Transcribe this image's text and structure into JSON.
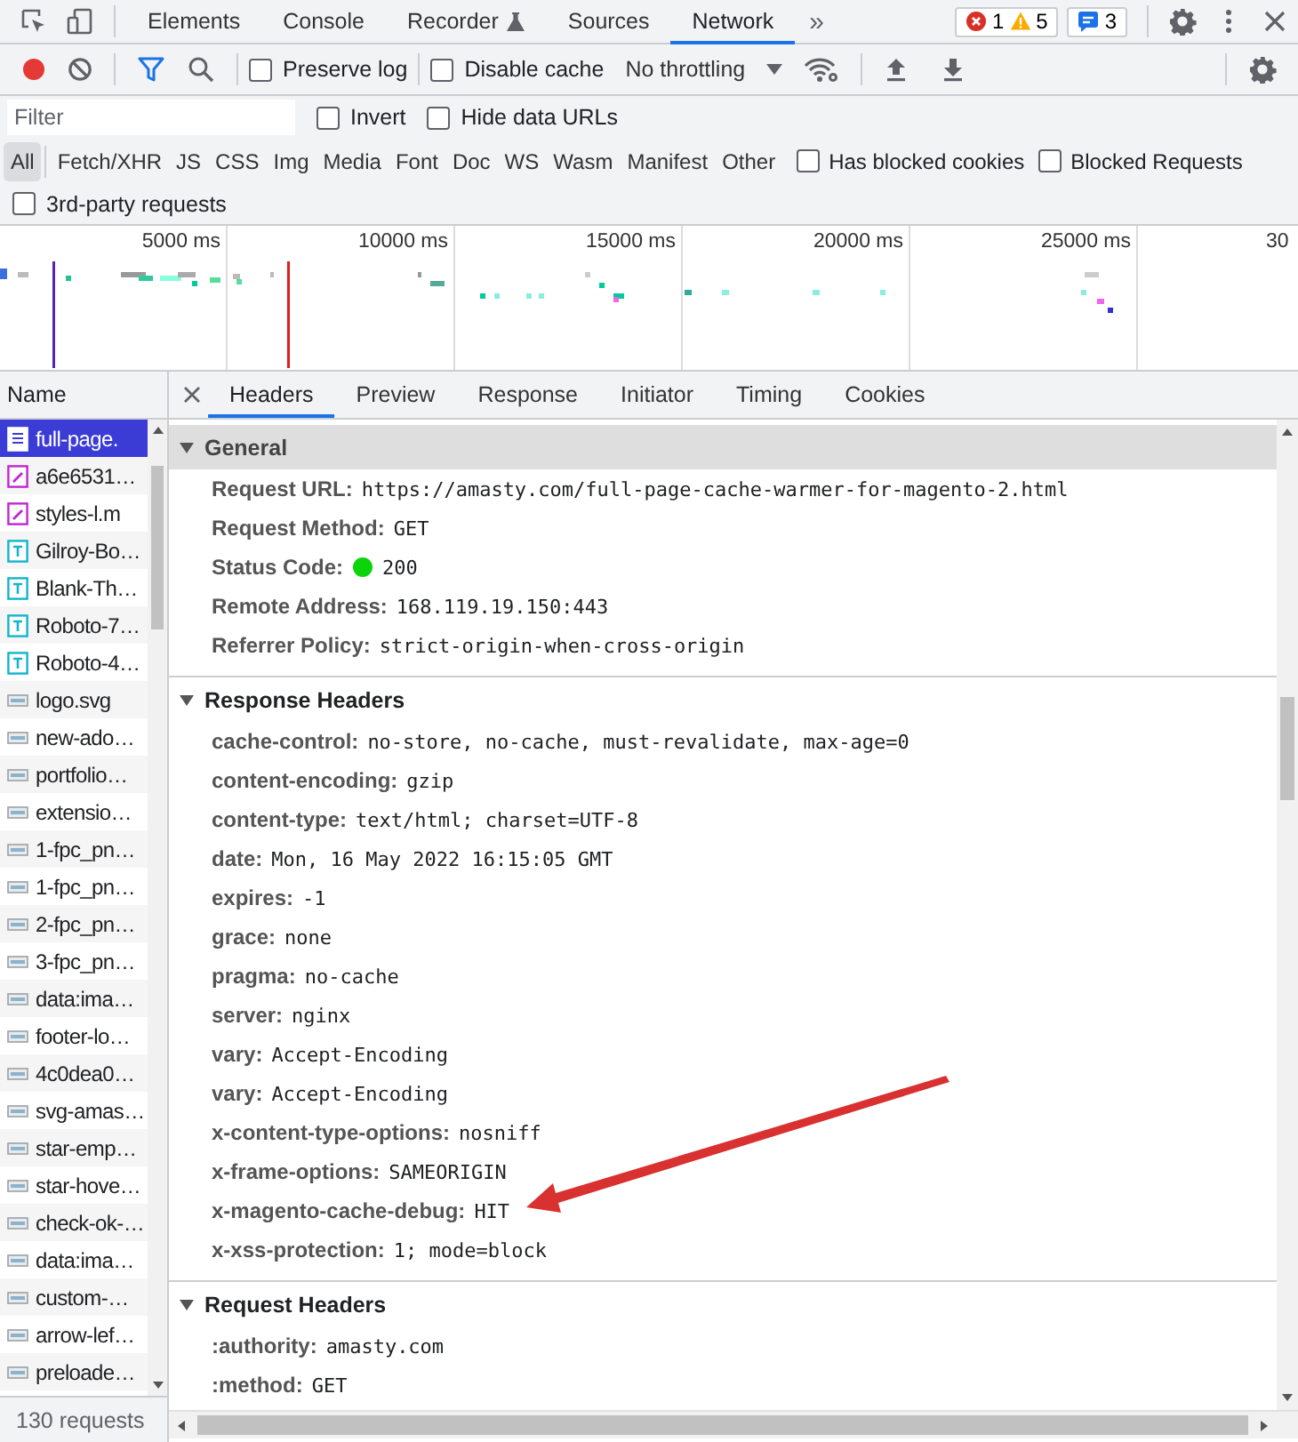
{
  "devtools_tabs": [
    {
      "label": "Elements",
      "selected": false,
      "experimental": false
    },
    {
      "label": "Console",
      "selected": false,
      "experimental": false
    },
    {
      "label": "Recorder",
      "selected": false,
      "experimental": true
    },
    {
      "label": "Sources",
      "selected": false,
      "experimental": false
    },
    {
      "label": "Network",
      "selected": true,
      "experimental": false
    }
  ],
  "more_tabs": "»",
  "counters": [
    {
      "kind": "error",
      "count": "1"
    },
    {
      "kind": "warning",
      "count": "5"
    },
    {
      "kind": "message",
      "count": "3"
    }
  ],
  "toolbar": {
    "recording": true,
    "options": [
      {
        "label": "Preserve log",
        "checked": false
      },
      {
        "label": "Disable cache",
        "checked": false
      }
    ],
    "throttling": "No throttling"
  },
  "filter": {
    "placeholder": "Filter",
    "options": [
      {
        "label": "Invert",
        "checked": false
      },
      {
        "label": "Hide data URLs",
        "checked": false
      }
    ]
  },
  "type_filters": [
    {
      "label": "All",
      "selected": true
    },
    {
      "label": "Fetch/XHR",
      "selected": false
    },
    {
      "label": "JS",
      "selected": false
    },
    {
      "label": "CSS",
      "selected": false
    },
    {
      "label": "Img",
      "selected": false
    },
    {
      "label": "Media",
      "selected": false
    },
    {
      "label": "Font",
      "selected": false
    },
    {
      "label": "Doc",
      "selected": false
    },
    {
      "label": "WS",
      "selected": false
    },
    {
      "label": "Wasm",
      "selected": false
    },
    {
      "label": "Manifest",
      "selected": false
    },
    {
      "label": "Other",
      "selected": false
    }
  ],
  "type_options": [
    {
      "label": "Has blocked cookies",
      "checked": false
    },
    {
      "label": "Blocked Requests",
      "checked": false
    }
  ],
  "third_party": {
    "label": "3rd-party requests",
    "checked": false
  },
  "timeline": {
    "ticks": [
      "5000 ms",
      "10000 ms",
      "15000 ms",
      "20000 ms",
      "25000 ms",
      "30"
    ]
  },
  "requests": {
    "column": "Name",
    "status": "130 requests",
    "rows": [
      {
        "name": "full-page.",
        "kind": "document",
        "selected": true
      },
      {
        "name": "a6e6531…",
        "kind": "script",
        "selected": false
      },
      {
        "name": "styles-l.m",
        "kind": "script",
        "selected": false
      },
      {
        "name": "Gilroy-Bo…",
        "kind": "font",
        "selected": false
      },
      {
        "name": "Blank-Th…",
        "kind": "font",
        "selected": false
      },
      {
        "name": "Roboto-7…",
        "kind": "font",
        "selected": false
      },
      {
        "name": "Roboto-4…",
        "kind": "font",
        "selected": false
      },
      {
        "name": "logo.svg",
        "kind": "image",
        "selected": false
      },
      {
        "name": "new-ado…",
        "kind": "image",
        "selected": false
      },
      {
        "name": "portfolio…",
        "kind": "image",
        "selected": false
      },
      {
        "name": "extensio…",
        "kind": "image",
        "selected": false
      },
      {
        "name": "1-fpc_pn…",
        "kind": "image",
        "selected": false
      },
      {
        "name": "1-fpc_pn…",
        "kind": "image",
        "selected": false
      },
      {
        "name": "2-fpc_pn…",
        "kind": "image",
        "selected": false
      },
      {
        "name": "3-fpc_pn…",
        "kind": "image",
        "selected": false
      },
      {
        "name": "data:ima…",
        "kind": "image",
        "selected": false
      },
      {
        "name": "footer-lo…",
        "kind": "image",
        "selected": false
      },
      {
        "name": "4c0dea0…",
        "kind": "image",
        "selected": false
      },
      {
        "name": "svg-amas…",
        "kind": "image",
        "selected": false
      },
      {
        "name": "star-emp…",
        "kind": "image",
        "selected": false
      },
      {
        "name": "star-hove…",
        "kind": "image",
        "selected": false
      },
      {
        "name": "check-ok-…",
        "kind": "image",
        "selected": false
      },
      {
        "name": "data:ima…",
        "kind": "image",
        "selected": false
      },
      {
        "name": "custom-…",
        "kind": "image",
        "selected": false
      },
      {
        "name": "arrow-lef…",
        "kind": "image",
        "selected": false
      },
      {
        "name": "preloade…",
        "kind": "image",
        "selected": false
      }
    ]
  },
  "details": {
    "tabs": [
      {
        "label": "Headers",
        "selected": true
      },
      {
        "label": "Preview",
        "selected": false
      },
      {
        "label": "Response",
        "selected": false
      },
      {
        "label": "Initiator",
        "selected": false
      },
      {
        "label": "Timing",
        "selected": false
      },
      {
        "label": "Cookies",
        "selected": false
      }
    ],
    "sections": [
      {
        "title": "General",
        "expanded": true,
        "highlighted": true,
        "rows": [
          {
            "key": "Request URL:",
            "value": "https://amasty.com/full-page-cache-warmer-for-magento-2.html",
            "kind": "plain"
          },
          {
            "key": "Request Method:",
            "value": "GET",
            "kind": "plain"
          },
          {
            "key": "Status Code:",
            "value": "200",
            "kind": "status"
          },
          {
            "key": "Remote Address:",
            "value": "168.119.19.150:443",
            "kind": "plain"
          },
          {
            "key": "Referrer Policy:",
            "value": "strict-origin-when-cross-origin",
            "kind": "plain"
          }
        ]
      },
      {
        "title": "Response Headers",
        "expanded": true,
        "highlighted": false,
        "rows": [
          {
            "key": "cache-control:",
            "value": "no-store, no-cache, must-revalidate, max-age=0",
            "kind": "plain"
          },
          {
            "key": "content-encoding:",
            "value": "gzip",
            "kind": "plain"
          },
          {
            "key": "content-type:",
            "value": "text/html; charset=UTF-8",
            "kind": "plain"
          },
          {
            "key": "date:",
            "value": "Mon, 16 May 2022 16:15:05 GMT",
            "kind": "plain"
          },
          {
            "key": "expires:",
            "value": "-1",
            "kind": "plain"
          },
          {
            "key": "grace:",
            "value": "none",
            "kind": "plain"
          },
          {
            "key": "pragma:",
            "value": "no-cache",
            "kind": "plain"
          },
          {
            "key": "server:",
            "value": "nginx",
            "kind": "plain"
          },
          {
            "key": "vary:",
            "value": "Accept-Encoding",
            "kind": "plain"
          },
          {
            "key": "vary:",
            "value": "Accept-Encoding",
            "kind": "plain"
          },
          {
            "key": "x-content-type-options:",
            "value": "nosniff",
            "kind": "plain"
          },
          {
            "key": "x-frame-options:",
            "value": "SAMEORIGIN",
            "kind": "plain"
          },
          {
            "key": "x-magento-cache-debug:",
            "value": "HIT",
            "kind": "plain"
          },
          {
            "key": "x-xss-protection:",
            "value": "1; mode=block",
            "kind": "plain"
          }
        ]
      },
      {
        "title": "Request Headers",
        "expanded": true,
        "highlighted": false,
        "rows": [
          {
            "key": ":authority:",
            "value": "amasty.com",
            "kind": "plain"
          },
          {
            "key": ":method:",
            "value": "GET",
            "kind": "plain"
          }
        ]
      }
    ]
  },
  "annotation_arrow": true
}
